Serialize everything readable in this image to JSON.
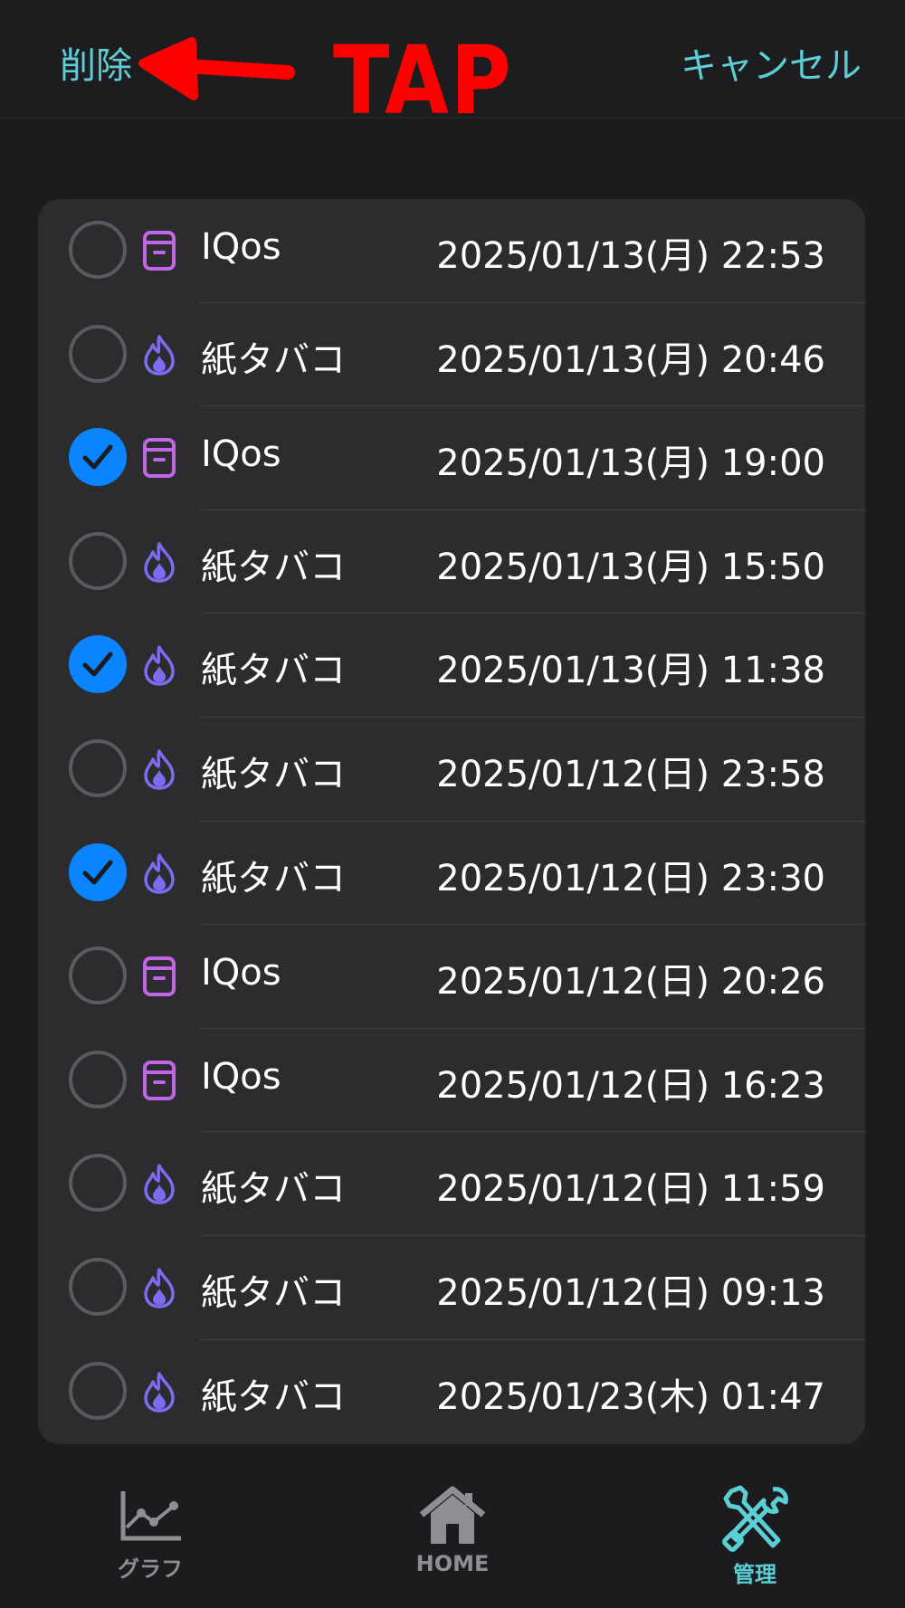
{
  "nav": {
    "delete_label": "削除",
    "cancel_label": "キャンセル"
  },
  "annotation": {
    "text": "TAP",
    "color": "#ff0000"
  },
  "colors": {
    "accent": "#5ccfd6",
    "checked": "#0a84ff",
    "iqos_icon": "#c066e8",
    "cigarette_icon": "#7c6cf0"
  },
  "records": [
    {
      "icon": "iqos-device-icon",
      "label": "IQos",
      "time": "2025/01/13(月) 22:53",
      "checked": false
    },
    {
      "icon": "flame-icon",
      "label": "紙タバコ",
      "time": "2025/01/13(月) 20:46",
      "checked": false
    },
    {
      "icon": "iqos-device-icon",
      "label": "IQos",
      "time": "2025/01/13(月) 19:00",
      "checked": true
    },
    {
      "icon": "flame-icon",
      "label": "紙タバコ",
      "time": "2025/01/13(月) 15:50",
      "checked": false
    },
    {
      "icon": "flame-icon",
      "label": "紙タバコ",
      "time": "2025/01/13(月) 11:38",
      "checked": true
    },
    {
      "icon": "flame-icon",
      "label": "紙タバコ",
      "time": "2025/01/12(日) 23:58",
      "checked": false
    },
    {
      "icon": "flame-icon",
      "label": "紙タバコ",
      "time": "2025/01/12(日) 23:30",
      "checked": true
    },
    {
      "icon": "iqos-device-icon",
      "label": "IQos",
      "time": "2025/01/12(日) 20:26",
      "checked": false
    },
    {
      "icon": "iqos-device-icon",
      "label": "IQos",
      "time": "2025/01/12(日) 16:23",
      "checked": false
    },
    {
      "icon": "flame-icon",
      "label": "紙タバコ",
      "time": "2025/01/12(日) 11:59",
      "checked": false
    },
    {
      "icon": "flame-icon",
      "label": "紙タバコ",
      "time": "2025/01/12(日) 09:13",
      "checked": false
    },
    {
      "icon": "flame-icon",
      "label": "紙タバコ",
      "time": "2025/01/23(木) 01:47",
      "checked": false
    }
  ],
  "tabs": [
    {
      "icon": "line-chart-icon",
      "label": "グラフ",
      "active": false
    },
    {
      "icon": "house-icon",
      "label": "HOME",
      "active": false
    },
    {
      "icon": "wrench-screwdriver-icon",
      "label": "管理",
      "active": true
    }
  ]
}
